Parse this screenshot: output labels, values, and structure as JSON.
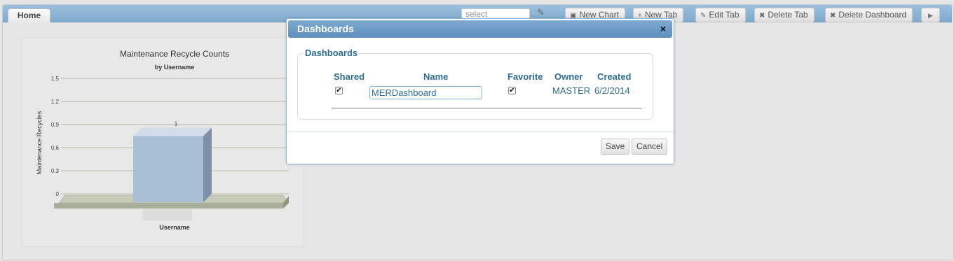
{
  "tabs": {
    "home": "Home"
  },
  "toolbar": {
    "select_placeholder": "select",
    "new_chart": "New Chart",
    "new_tab": "New Tab",
    "edit_tab": "Edit Tab",
    "delete_tab": "Delete Tab",
    "delete_dashboard": "Delete Dashboard"
  },
  "chart_data": {
    "type": "bar",
    "title": "Maintenance Recycle Counts",
    "subtitle": "by Username",
    "xlabel": "Username",
    "ylabel": "Maintenance Recycles",
    "categories": [
      ""
    ],
    "values": [
      1
    ],
    "data_labels": [
      "1"
    ],
    "yticks": [
      "0",
      "0.3",
      "0.6",
      "0.9",
      "1.2",
      "1.5"
    ],
    "ylim": [
      0,
      1.5
    ],
    "grid": true,
    "style": "3d",
    "bar_color": "#a9bfd6"
  },
  "modal": {
    "title": "Dashboards",
    "close_icon": "×",
    "legend": "Dashboards",
    "columns": {
      "shared": "Shared",
      "name": "Name",
      "favorite": "Favorite",
      "owner": "Owner",
      "created": "Created"
    },
    "rows": [
      {
        "shared": true,
        "name": "MERDashboard",
        "favorite": true,
        "owner": "MASTER",
        "created": "6/2/2014"
      }
    ],
    "save_label": "Save",
    "cancel_label": "Cancel"
  }
}
